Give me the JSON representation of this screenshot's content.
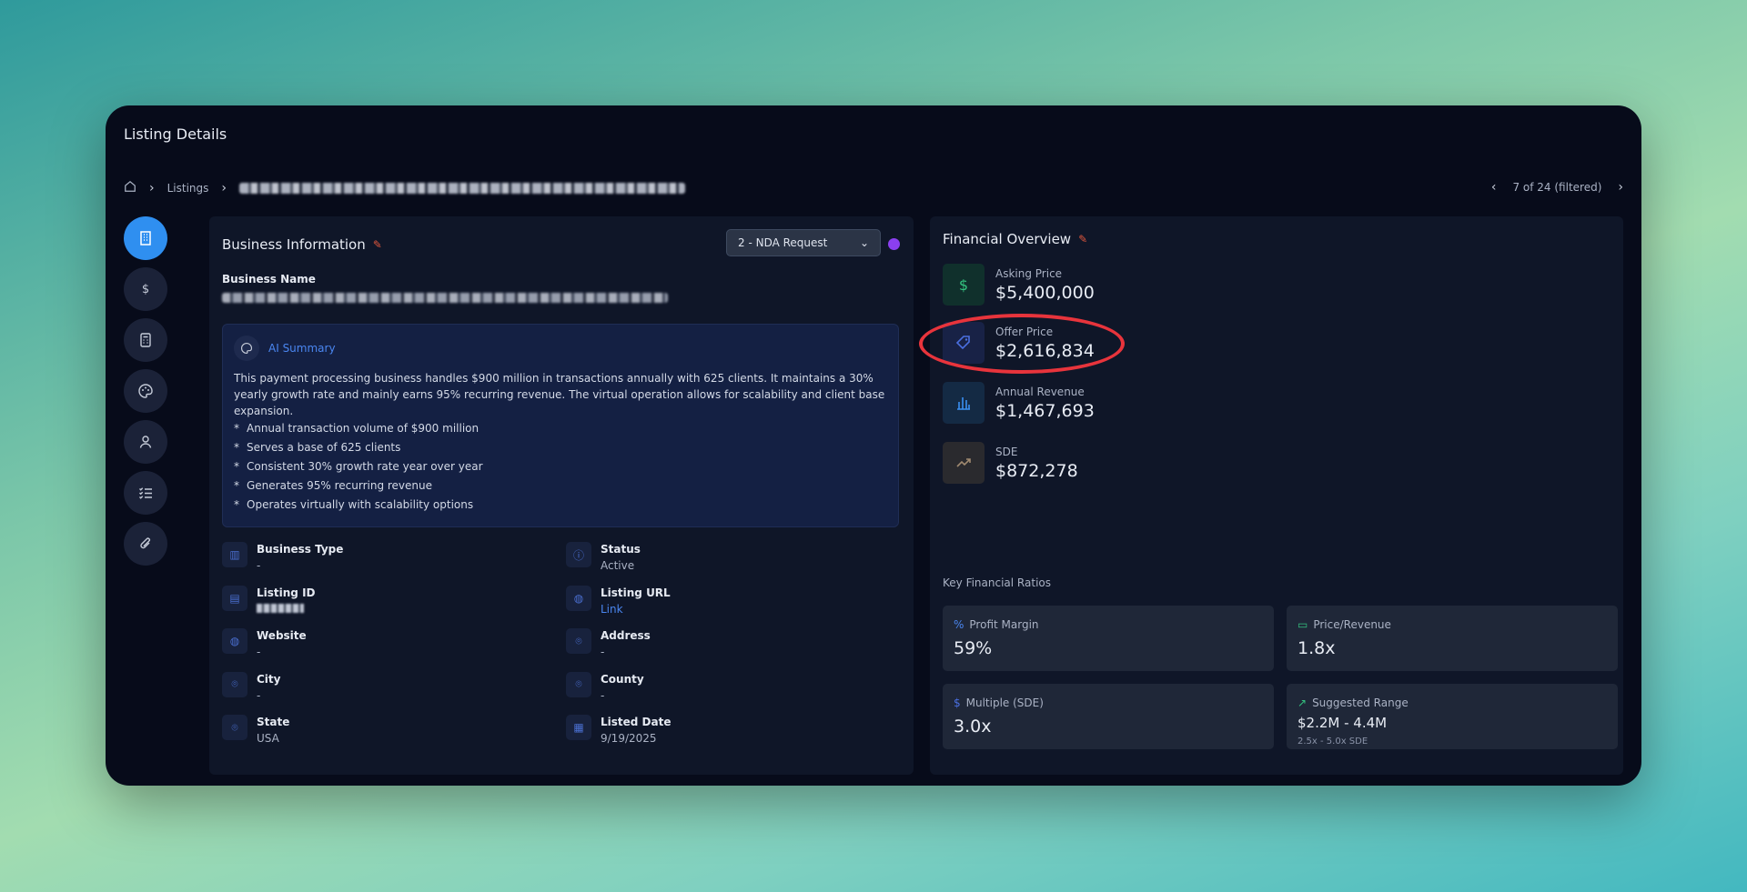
{
  "window": {
    "title": "Listing Details"
  },
  "breadcrumb": {
    "home_icon": "home-icon",
    "items": [
      "Listings"
    ]
  },
  "pager": {
    "text": "7 of 24 (filtered)"
  },
  "rail": [
    "building-icon",
    "dollar-icon",
    "calculator-icon",
    "palette-icon",
    "user-icon",
    "checklist-icon",
    "paperclip-icon"
  ],
  "business": {
    "title": "Business Information",
    "stage_select": "2 - NDA Request",
    "name_label": "Business Name",
    "ai": {
      "label": "AI Summary",
      "text": "This payment processing business handles $900 million in transactions annually with 625 clients. It maintains a 30% yearly growth rate and mainly earns 95% recurring revenue. The virtual operation allows for scalability and client base expansion.",
      "bullets": [
        "Annual transaction volume of $900 million",
        "Serves a base of 625 clients",
        "Consistent 30% growth rate year over year",
        "Generates 95% recurring revenue",
        "Operates virtually with scalability options"
      ]
    },
    "fields": {
      "business_type": {
        "label": "Business Type",
        "value": "-"
      },
      "status": {
        "label": "Status",
        "value": "Active"
      },
      "listing_id": {
        "label": "Listing ID"
      },
      "listing_url": {
        "label": "Listing URL",
        "value": "Link"
      },
      "website": {
        "label": "Website",
        "value": "-"
      },
      "address": {
        "label": "Address",
        "value": "-"
      },
      "city": {
        "label": "City",
        "value": "-"
      },
      "county": {
        "label": "County",
        "value": "-"
      },
      "state": {
        "label": "State",
        "value": "USA"
      },
      "listed_date": {
        "label": "Listed Date",
        "value": "9/19/2025"
      }
    }
  },
  "financial": {
    "title": "Financial Overview",
    "asking": {
      "label": "Asking Price",
      "value": "$5,400,000",
      "icon": "$"
    },
    "offer": {
      "label": "Offer Price",
      "value": "$2,616,834"
    },
    "revenue": {
      "label": "Annual Revenue",
      "value": "$1,467,693"
    },
    "sde": {
      "label": "SDE",
      "value": "$872,278"
    },
    "ratios_title": "Key Financial Ratios",
    "ratios": {
      "profit_margin": {
        "label": "Profit Margin",
        "value": "59%"
      },
      "price_revenue": {
        "label": "Price/Revenue",
        "value": "1.8x"
      },
      "multiple": {
        "label": "Multiple (SDE)",
        "value": "3.0x"
      },
      "suggested": {
        "label": "Suggested Range",
        "value": "$2.2M - 4.4M",
        "sub": "2.5x - 5.0x SDE"
      }
    }
  },
  "colors": {
    "accent": "#2f8ff0",
    "annotation": "#e8343c",
    "status_dot": "#8b3ff0"
  }
}
